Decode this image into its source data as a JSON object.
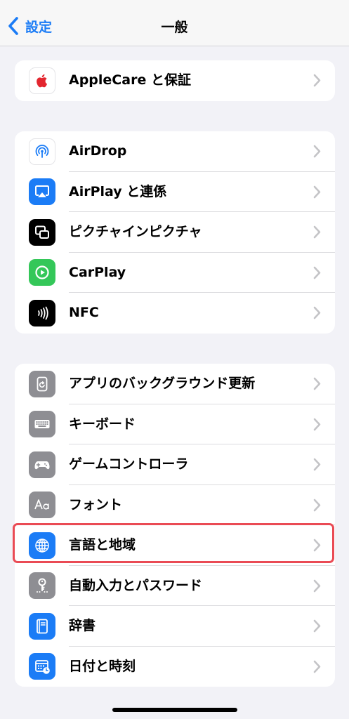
{
  "nav": {
    "back_label": "設定",
    "title": "一般"
  },
  "groups": [
    {
      "items": [
        {
          "label": "AppleCare と保証",
          "icon": "apple-logo-icon",
          "icon_bg": "#ffffff",
          "icon_fg": "#e3262f"
        }
      ]
    },
    {
      "items": [
        {
          "label": "AirDrop",
          "icon": "airdrop-icon",
          "icon_bg": "#ffffff",
          "icon_fg": "#1b7cf6"
        },
        {
          "label": "AirPlay と連係",
          "icon": "airplay-icon",
          "icon_bg": "#1b7cf6",
          "icon_fg": "#ffffff"
        },
        {
          "label": "ピクチャインピクチャ",
          "icon": "picture-in-picture-icon",
          "icon_bg": "#000000",
          "icon_fg": "#ffffff"
        },
        {
          "label": "CarPlay",
          "icon": "carplay-icon",
          "icon_bg": "#34c759",
          "icon_fg": "#ffffff"
        },
        {
          "label": "NFC",
          "icon": "nfc-icon",
          "icon_bg": "#000000",
          "icon_fg": "#ffffff"
        }
      ]
    },
    {
      "items": [
        {
          "label": "アプリのバックグラウンド更新",
          "icon": "background-refresh-icon",
          "icon_bg": "#8e8e93",
          "icon_fg": "#ffffff"
        },
        {
          "label": "キーボード",
          "icon": "keyboard-icon",
          "icon_bg": "#8e8e93",
          "icon_fg": "#ffffff"
        },
        {
          "label": "ゲームコントローラ",
          "icon": "game-controller-icon",
          "icon_bg": "#8e8e93",
          "icon_fg": "#ffffff"
        },
        {
          "label": "フォント",
          "icon": "font-icon",
          "icon_bg": "#8e8e93",
          "icon_fg": "#ffffff"
        },
        {
          "label": "言語と地域",
          "icon": "globe-icon",
          "icon_bg": "#1b7cf6",
          "icon_fg": "#ffffff",
          "highlighted": true
        },
        {
          "label": "自動入力とパスワード",
          "icon": "key-icon",
          "icon_bg": "#8e8e93",
          "icon_fg": "#ffffff"
        },
        {
          "label": "辞書",
          "icon": "dictionary-icon",
          "icon_bg": "#1b7cf6",
          "icon_fg": "#ffffff"
        },
        {
          "label": "日付と時刻",
          "icon": "calendar-clock-icon",
          "icon_bg": "#1b7cf6",
          "icon_fg": "#ffffff"
        }
      ]
    }
  ],
  "colors": {
    "accent": "#1b7cf6",
    "highlight_border": "#ea4b55",
    "chevron": "#c4c4c7"
  }
}
